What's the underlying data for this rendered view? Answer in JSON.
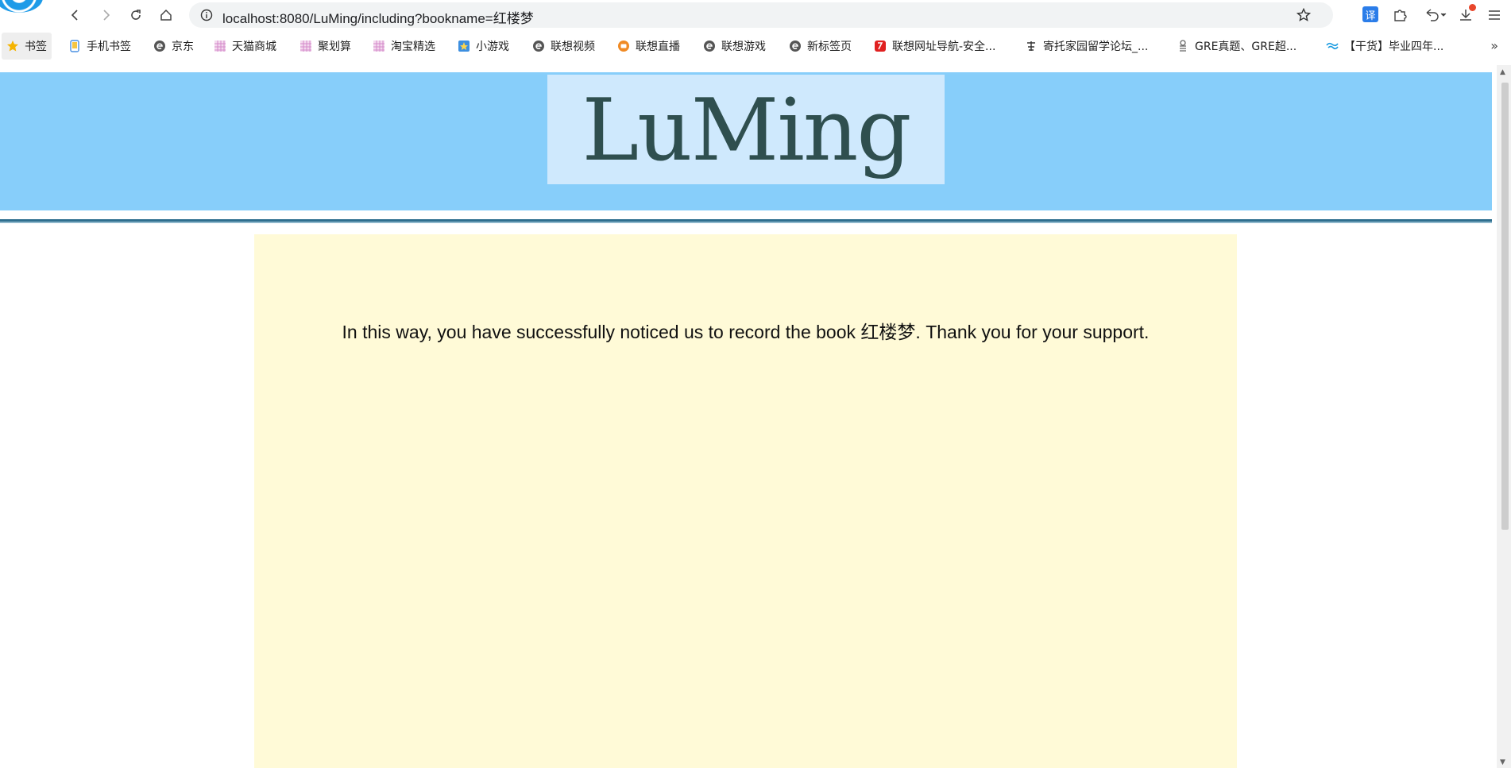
{
  "browser": {
    "url": "localhost:8080/LuMing/including?bookname=红楼梦",
    "translate_label": "译"
  },
  "bookmarks": [
    {
      "label": "书签",
      "icon": "star-icon",
      "color": "#f5b400"
    },
    {
      "label": "手机书签",
      "icon": "phone-icon",
      "color": "#4a90e2"
    },
    {
      "label": "京东",
      "icon": "e-icon",
      "color": "#555555"
    },
    {
      "label": "天猫商城",
      "icon": "grid-icon",
      "color": "#d48acb"
    },
    {
      "label": "聚划算",
      "icon": "grid-icon",
      "color": "#d48acb"
    },
    {
      "label": "淘宝精选",
      "icon": "grid-icon",
      "color": "#d48acb"
    },
    {
      "label": "小游戏",
      "icon": "game-icon",
      "color": "#3d8fe0"
    },
    {
      "label": "联想视频",
      "icon": "e-icon",
      "color": "#555555"
    },
    {
      "label": "联想直播",
      "icon": "live-icon",
      "color": "#f08a24"
    },
    {
      "label": "联想游戏",
      "icon": "e-icon",
      "color": "#555555"
    },
    {
      "label": "新标签页",
      "icon": "e-icon",
      "color": "#555555"
    },
    {
      "label": "联想网址导航-安全...",
      "icon": "lenovo-icon",
      "color": "#e02020"
    },
    {
      "label": "寄托家园留学论坛_...",
      "icon": "jituo-icon",
      "color": "#333333"
    },
    {
      "label": "GRE真题、GRE超...",
      "icon": "gre-icon",
      "color": "#666666"
    },
    {
      "label": "【干货】毕业四年...",
      "icon": "wave-icon",
      "color": "#1a9be0"
    }
  ],
  "page": {
    "logo": "LuMing",
    "message": "In this way, you have successfully noticed us to record the book 红楼梦. Thank you for your support."
  },
  "colors": {
    "header_band": "#87cefa",
    "logo_box": "#cfe9fd",
    "logo_text": "#2f4f4f",
    "content_bg": "#fffad7"
  }
}
